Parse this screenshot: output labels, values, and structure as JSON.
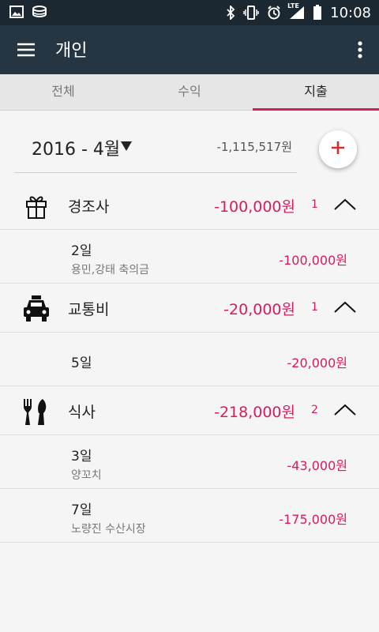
{
  "status_bar": {
    "time": "10:08",
    "network": "LTE",
    "left_icons": [
      "image-icon",
      "coin-stack-icon"
    ],
    "right_icons": [
      "bluetooth-icon",
      "vibrate-icon",
      "alarm-icon",
      "signal-icon",
      "battery-icon"
    ]
  },
  "app_bar": {
    "title": "개인",
    "menu_icon": "hamburger-icon",
    "more_icon": "more-vert-icon"
  },
  "tabs": [
    {
      "label": "전체",
      "active": false
    },
    {
      "label": "수익",
      "active": false
    },
    {
      "label": "지출",
      "active": true
    }
  ],
  "period": {
    "label": "2016 - 4월",
    "caret": "▼",
    "total": "-1,115,517원"
  },
  "fab": {
    "icon": "plus-icon",
    "color": "#d32f2f"
  },
  "colors": {
    "accent": "#d81b60",
    "status_bar": "#1b2731",
    "app_bar": "#253642"
  },
  "categories": [
    {
      "label": "경조사",
      "icon": "gift-icon",
      "amount": "-100,000원",
      "count": "1",
      "items": [
        {
          "day": "2일",
          "memo": "용민,강태 축의금",
          "amount": "-100,000원"
        }
      ]
    },
    {
      "label": "교통비",
      "icon": "taxi-icon",
      "amount": "-20,000원",
      "count": "1",
      "items": [
        {
          "day": "5일",
          "memo": "",
          "amount": "-20,000원"
        }
      ]
    },
    {
      "label": "식사",
      "icon": "fork-knife-icon",
      "amount": "-218,000원",
      "count": "2",
      "items": [
        {
          "day": "3일",
          "memo": "양꼬치",
          "amount": "-43,000원"
        },
        {
          "day": "7일",
          "memo": "노량진 수산시장",
          "amount": "-175,000원"
        }
      ]
    }
  ]
}
